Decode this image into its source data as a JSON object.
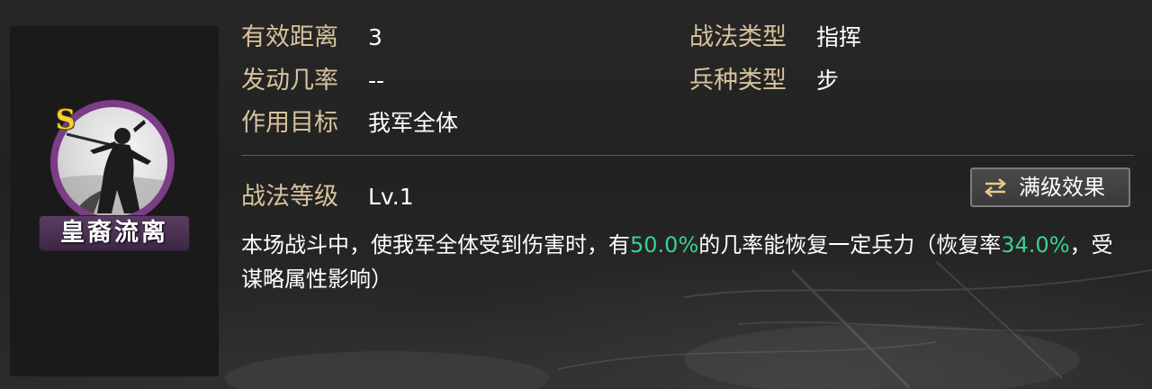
{
  "skill_card": {
    "grade": "S",
    "name": "皇裔流离"
  },
  "attributes": {
    "range_label": "有效距离",
    "range_value": "3",
    "chance_label": "发动几率",
    "chance_value": "--",
    "target_label": "作用目标",
    "target_value": "我军全体",
    "tactic_type_label": "战法类型",
    "tactic_type_value": "指挥",
    "troop_type_label": "兵种类型",
    "troop_type_value": "步"
  },
  "level": {
    "label": "战法等级",
    "value": "Lv.1"
  },
  "max_effect_button": {
    "label": "满级效果",
    "icon": "swap-arrows-icon"
  },
  "description": {
    "part1": "本场战斗中，使我军全体受到伤害时，有",
    "chance_highlight": "50.0%",
    "part2": "的几率能恢复一定兵力（恢复率",
    "rate_highlight": "34.0%",
    "part3": "，受谋略属性影响）"
  },
  "colors": {
    "label_gold": "#d7c39b",
    "highlight_green": "#39d28f",
    "grade_gold": "#f2cf3b",
    "portrait_ring": "#7b3d85"
  }
}
